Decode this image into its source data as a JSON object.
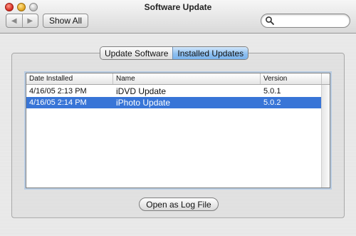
{
  "window": {
    "title": "Software Update"
  },
  "toolbar": {
    "back_glyph": "◀",
    "forward_glyph": "▶",
    "show_all_label": "Show All",
    "search_value": "",
    "search_placeholder": ""
  },
  "tabs": [
    {
      "label": "Update Software",
      "selected": false
    },
    {
      "label": "Installed Updates",
      "selected": true
    }
  ],
  "table": {
    "columns": [
      "Date Installed",
      "Name",
      "Version"
    ],
    "rows": [
      {
        "date": "4/16/05 2:13 PM",
        "name": "iDVD Update",
        "version": "5.0.1",
        "selected": false
      },
      {
        "date": "4/16/05 2:14 PM",
        "name": "iPhoto Update",
        "version": "5.0.2",
        "selected": true
      }
    ]
  },
  "footer": {
    "log_button_label": "Open as Log File"
  },
  "colors": {
    "selection": "#3875d7",
    "tab_selected": "#8ec0f0"
  },
  "icons": [
    "back-arrow-icon",
    "forward-arrow-icon",
    "search-icon"
  ]
}
